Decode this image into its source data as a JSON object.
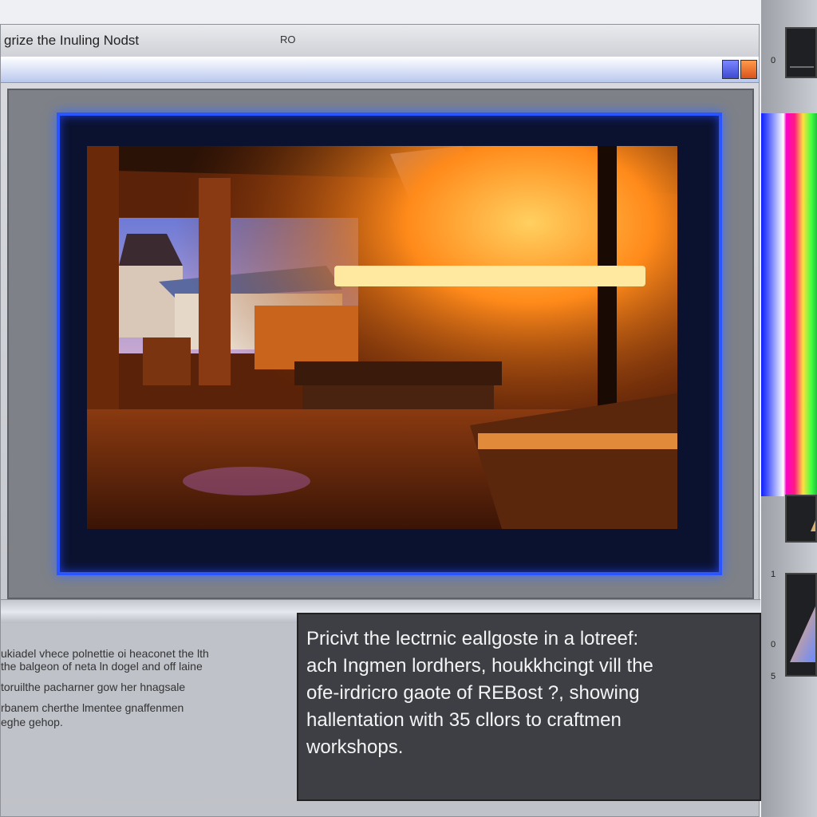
{
  "window": {
    "title": "grize the Inuling Nodst",
    "title_mid": "RO",
    "accent_blue": "#2a55ff",
    "accent_orange": "#d9531c"
  },
  "side_panel": {
    "lines": [
      "ukiadel vhece polnettie oi heaconet the lth",
      "the balgeon of neta ln dogel and off laine",
      "toruilthe pacharner gow her hnagsale",
      "rbanem cherthe lmentee gnaffenmen",
      "eghe gehop."
    ]
  },
  "caption": {
    "lines": [
      "Pricivt the lectrnic eallgoste in a lotreef:",
      "ach Ingmen lordhers, houkkhcingt vill the",
      "ofe-irdricro gaote of REBost ?, showing",
      "hallentation with 35 cllors to craftmen",
      "workshops."
    ]
  },
  "sidebar": {
    "numbers": [
      "0",
      "1",
      "0",
      "5"
    ],
    "icons": [
      "preview-thumbnail-icon",
      "triangle-icon"
    ]
  }
}
